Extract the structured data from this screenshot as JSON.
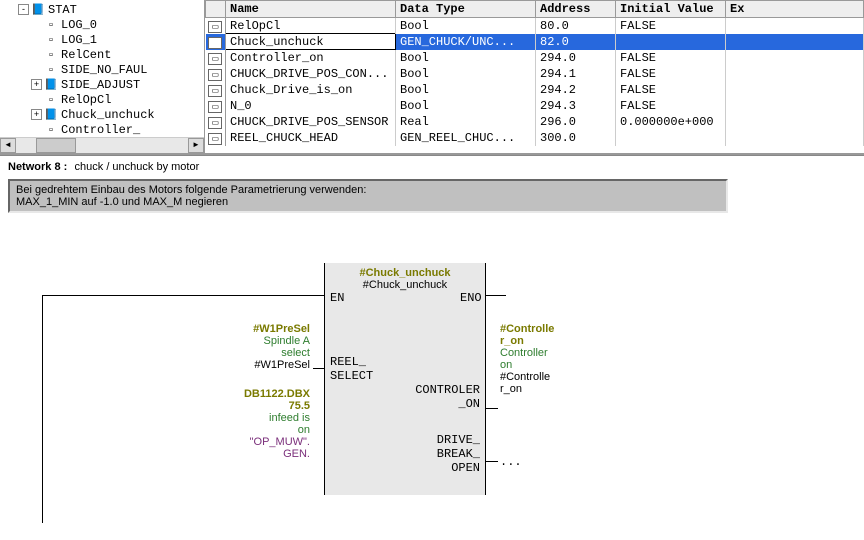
{
  "tree": {
    "root": "STAT",
    "items": [
      "LOG_0",
      "LOG_1",
      "RelCent",
      "SIDE_NO_FAUL",
      "SIDE_ADJUST",
      "RelOpCl",
      "Chuck_unchuck",
      "Controller_"
    ]
  },
  "table": {
    "headers": [
      "Name",
      "Data Type",
      "Address",
      "Initial Value",
      "Ex"
    ],
    "rows": [
      {
        "name": "RelOpCl",
        "type": "Bool",
        "addr": "80.0",
        "init": "FALSE",
        "sel": false
      },
      {
        "name": "Chuck_unchuck",
        "type": "GEN_CHUCK/UNC...",
        "addr": "82.0",
        "init": "",
        "sel": true
      },
      {
        "name": "Controller_on",
        "type": "Bool",
        "addr": "294.0",
        "init": "FALSE",
        "sel": false
      },
      {
        "name": "CHUCK_DRIVE_POS_CON...",
        "type": "Bool",
        "addr": "294.1",
        "init": "FALSE",
        "sel": false
      },
      {
        "name": "Chuck_Drive_is_on",
        "type": "Bool",
        "addr": "294.2",
        "init": "FALSE",
        "sel": false
      },
      {
        "name": "N_0",
        "type": "Bool",
        "addr": "294.3",
        "init": "FALSE",
        "sel": false
      },
      {
        "name": "CHUCK_DRIVE_POS_SENSOR",
        "type": "Real",
        "addr": "296.0",
        "init": "0.000000e+000",
        "sel": false
      },
      {
        "name": "REEL_CHUCK_HEAD",
        "type": "GEN_REEL_CHUC...",
        "addr": "300.0",
        "init": "",
        "sel": false
      }
    ]
  },
  "network": {
    "num": "8",
    "title": "chuck / unchuck by motor"
  },
  "comment": {
    "l1": "Bei gedrehtem Einbau des Motors folgende Parametrierung verwenden:",
    "l2": "MAX_1_MIN auf -1.0 und MAX_M negieren"
  },
  "fb": {
    "title": "#Chuck_unchuck",
    "sub": "#Chuck_unchuck",
    "en": "EN",
    "eno": "ENO",
    "in1_hdr": "#W1PreSel",
    "in1_l1": "Spindle A",
    "in1_l2": "select",
    "in1_val": "#W1PreSel",
    "in1_pin": "REEL_\nSELECT",
    "in2_hdr": "DB1122.DBX",
    "in2_hdr2": "75.5",
    "in2_l1": "infeed is",
    "in2_l2": "on",
    "in2_val": "\"OP_MUW\".",
    "in2_val2": "GEN.",
    "mid_pin": "CONTROLER\n_ON",
    "mid_pin2": "DRIVE_\nBREAK_\nOPEN",
    "out1_hdr": "#Controlle",
    "out1_hdr2": "r_on",
    "out1_l1": "Controller",
    "out1_l2": "on",
    "out1_val": "#Controlle",
    "out1_val2": "r_on",
    "out_dots": "..."
  }
}
